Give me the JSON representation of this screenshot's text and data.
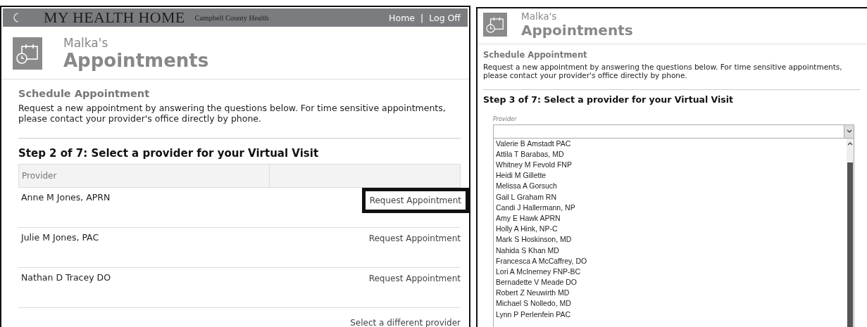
{
  "left_panel": {
    "top_bar": {
      "logo": "MY HEALTH HOME",
      "subtitle": "Campbell County Health",
      "links": [
        "Home",
        "Log Off"
      ],
      "separator": "|"
    },
    "owner": "Malka's",
    "title": "Appointments",
    "section_title": "Schedule Appointment",
    "intro": "Request a new appointment by answering the questions below. For time sensitive appointments, please contact your provider's office directly by phone.",
    "step_heading": "Step 2 of 7: Select a provider for your Virtual Visit",
    "table": {
      "columns": [
        "Provider"
      ],
      "rows": [
        {
          "provider": "Anne M Jones, APRN",
          "action": "Request Appointment",
          "highlighted": true
        },
        {
          "provider": "Julie M Jones, PAC",
          "action": "Request Appointment",
          "highlighted": false
        },
        {
          "provider": "Nathan D Tracey DO",
          "action": "Request Appointment",
          "highlighted": false
        }
      ]
    },
    "footer_link": "Select a different provider"
  },
  "right_panel": {
    "owner": "Malka's",
    "title": "Appointments",
    "section_title": "Schedule Appointment",
    "intro": "Request a new appointment by answering the questions below. For time sensitive appointments, please contact your provider's office directly by phone.",
    "step_heading": "Step 3 of 7: Select a provider for your Virtual Visit",
    "provider_field": {
      "label": "Provider"
    },
    "provider_options": [
      "Valerie B Amstadt PAC",
      "Attila T Barabas, MD",
      "Whitney M Fevold FNP",
      "Heidi M Gillette",
      "Melissa A Gorsuch",
      "Gail L Graham RN",
      "Candi J Hallermann, NP",
      "Amy E Hawk APRN",
      "Holly A Hink, NP-C",
      "Mark S Hoskinson, MD",
      "Nahida S Khan MD",
      "Francesca A McCaffrey, DO",
      "Lori A McInerney FNP-BC",
      "Bernadette V Meade DO",
      "Robert Z Neuwirth MD",
      "Michael S Nolledo, MD",
      "Lynn P Perlenfein PAC"
    ]
  }
}
